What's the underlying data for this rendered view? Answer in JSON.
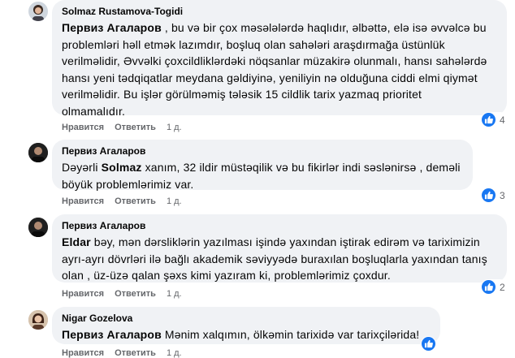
{
  "comments": [
    {
      "author": "Solmaz Rustamova-Togidi",
      "mention": "",
      "lines": [
        "Первиз Агаларов , bu və bir çox məsələlərdə haqlıdır, əlbəttə, elə isə əvvəlcə bu",
        "problemləri həll etmək lazımdır, boşluq olan sahələri araşdırmağa üstünlük",
        "verilməlidir, Əvvəlki çoxcildliklərdəki nöqsanlar müzakirə olunmalı, hansı sahələrdə",
        "hansı yeni tədqiqatlar meydana gəldiyinə, yeniliyin nə olduğuna ciddi elmi qiymət",
        "verilməlidir. Bu işlər görülməmiş tələsik 15 cildlik tarix yazmaq prioritet",
        "olmamalıdır."
      ],
      "like": "Нравится",
      "reply": "Ответить",
      "time": "1 д.",
      "reactions": "4"
    },
    {
      "author": "Первиз Агаларов",
      "lines": [
        "Dəyərli Solmaz xanım, 32 ildir müstəqilik və bu fikirlər indi səslənirsə , deməli",
        "böyük problemlərimiz var."
      ],
      "like": "Нравится",
      "reply": "Ответить",
      "time": "1 д.",
      "reactions": "3"
    },
    {
      "author": "Первиз Агаларов",
      "lines": [
        "Eldar bəy, mən dərsliklərin yazılması işində yaxından iştirak edirəm və tariximizin",
        "ayrı-ayrı dövrləri ilə bağlı akademik səviyyədə buraxılan boşluqlarla yaxından tanış",
        "olan , üz-üzə qalan şəxs kimi yazıram ki, problemlərimiz çoxdur."
      ],
      "like": "Нравится",
      "reply": "Ответить",
      "time": "1 д.",
      "reactions": "2"
    },
    {
      "author": "Nigar Gozelova",
      "lines": [
        "Первиз Агаларов Mənim xalqımın, ölkəmin tarixidə var tarixçilərida!"
      ],
      "like": "Нравится",
      "reply": "Ответить",
      "time": "1 д."
    }
  ],
  "icons": {
    "reaction": "like-icon"
  },
  "colors": {
    "bubble": "#f0f2f5",
    "like": "#1877f2",
    "meta": "#65676b"
  }
}
